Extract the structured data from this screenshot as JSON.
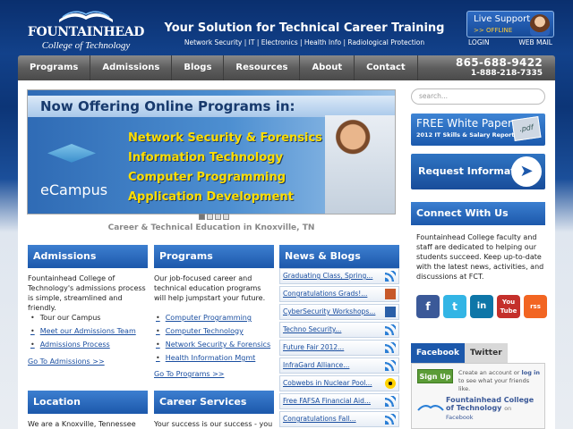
{
  "header": {
    "logo_name": "FOUNTAINHEAD",
    "logo_sub": "College of Technology",
    "tagline": "Your Solution for Technical Career Training",
    "sublinks": "Network Security | IT | Electronics | Health Info | Radiological Protection",
    "live_support": "Live Support",
    "live_status": ">>   OFFLINE",
    "login": "LOGIN",
    "webmail": "WEB MAIL"
  },
  "nav": {
    "items": [
      "Programs",
      "Admissions",
      "Blogs",
      "Resources",
      "About",
      "Contact"
    ],
    "phone1": "865-688-9422",
    "phone2": "1-888-218-7335"
  },
  "banner": {
    "heading": "Now Offering Online Programs in:",
    "lines": [
      "Network Security & Forensics",
      "Information Technology",
      "Computer Programming",
      "Application Development"
    ],
    "ecampus": "eCampus",
    "caption": "Career & Technical Education in Knoxville, TN"
  },
  "admissions": {
    "title": "Admissions",
    "text": "Fountainhead College of Technology's admissions process is simple, streamlined and friendly.",
    "items": [
      "Tour our Campus",
      "Meet our Admissions Team",
      "Admissions Process"
    ],
    "link": "Go To Admissions >>"
  },
  "programs": {
    "title": "Programs",
    "text": "Our job-focused career and technical education programs will help jumpstart your future.",
    "items": [
      "Computer Programming",
      "Computer Technology",
      "Network Security & Forensics",
      "Health Information Mgmt"
    ],
    "link": "Go To Programs >>"
  },
  "news": {
    "title": "News & Blogs",
    "items": [
      "Graduating Class, Spring...",
      "Congratulations Grads!...",
      "CyberSecurity Workshops...",
      "Techno Security...",
      "Future Fair 2012...",
      "InfraGard Alliance...",
      "Cobwebs in Nuclear Pool...",
      "Free FAFSA Financial Aid...",
      "Congratulations Fall..."
    ]
  },
  "location": {
    "title": "Location",
    "text": "We are a Knoxville, Tennessee"
  },
  "career": {
    "title": "Career Services",
    "text": "Your success is our success - you"
  },
  "sidebar": {
    "search_placeholder": "search...",
    "whitepaper_title": "FREE White Paper",
    "whitepaper_sub": "2012 IT Skills & Salary Report",
    "pdf": ".pdf",
    "request": "Request Information",
    "connect": "Connect With Us",
    "connect_text": "Fountainhead College faculty and staff are dedicated to helping our students succeed. Keep up-to-date with the latest news, activities, and discussions at FCT.",
    "social": [
      "f",
      "t",
      "in",
      "You Tube",
      "rss"
    ],
    "tab_facebook": "Facebook",
    "tab_twitter": "Twitter",
    "signup": "Sign Up",
    "signup_text_a": "Create an account or",
    "signup_login": "log in",
    "signup_text_b": "to see what your friends like.",
    "fb_page": "Fountainhead College of Technology",
    "fb_on": "on",
    "fb_src": "Facebook"
  },
  "colors": {
    "brand_blue": "#1c58ab",
    "nav_gray": "#5d5d5d",
    "accent_yellow": "#ffde00"
  }
}
